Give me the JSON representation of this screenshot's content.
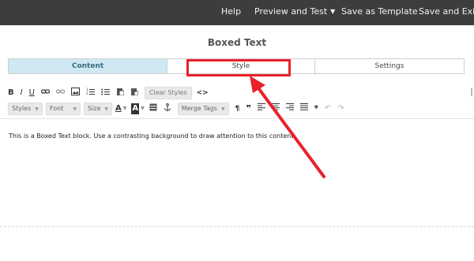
{
  "topbar": {
    "help": "Help",
    "preview_and_test": "Preview and Test",
    "save_as_template": "Save as Template",
    "save_and_exit": "Save and Exit",
    "caret": "▼"
  },
  "panel": {
    "title": "Boxed Text"
  },
  "tabs": [
    {
      "label": "Content",
      "active": true
    },
    {
      "label": "Style",
      "active": false
    },
    {
      "label": "Settings",
      "active": false
    }
  ],
  "toolbar": {
    "row1": {
      "bold": "B",
      "italic": "I",
      "underline": "U",
      "icons": [
        "link-icon",
        "unlink-icon",
        "image-icon",
        "numbered-list-icon",
        "bulleted-list-icon",
        "paste-from-word-icon",
        "remove-format-icon"
      ],
      "clear_styles": "Clear Styles",
      "source_code": "<>"
    },
    "row2": {
      "styles": "Styles",
      "font": "Font",
      "size": "Size",
      "text_color": "A",
      "background_color": "A",
      "merge_tags": "Merge Tags",
      "caret": "▼",
      "icons": [
        "table-icon",
        "anchor-icon",
        "paragraph-icon",
        "block-quote-icon",
        "align-left-icon",
        "align-center-icon",
        "align-right-icon",
        "justify-icon",
        "special-character-icon",
        "undo-icon",
        "redo-icon"
      ]
    }
  },
  "editor": {
    "content": "This is a Boxed Text block. Use a contrasting background to draw attention to this content."
  },
  "annotation": {
    "color": "#e8222a"
  }
}
